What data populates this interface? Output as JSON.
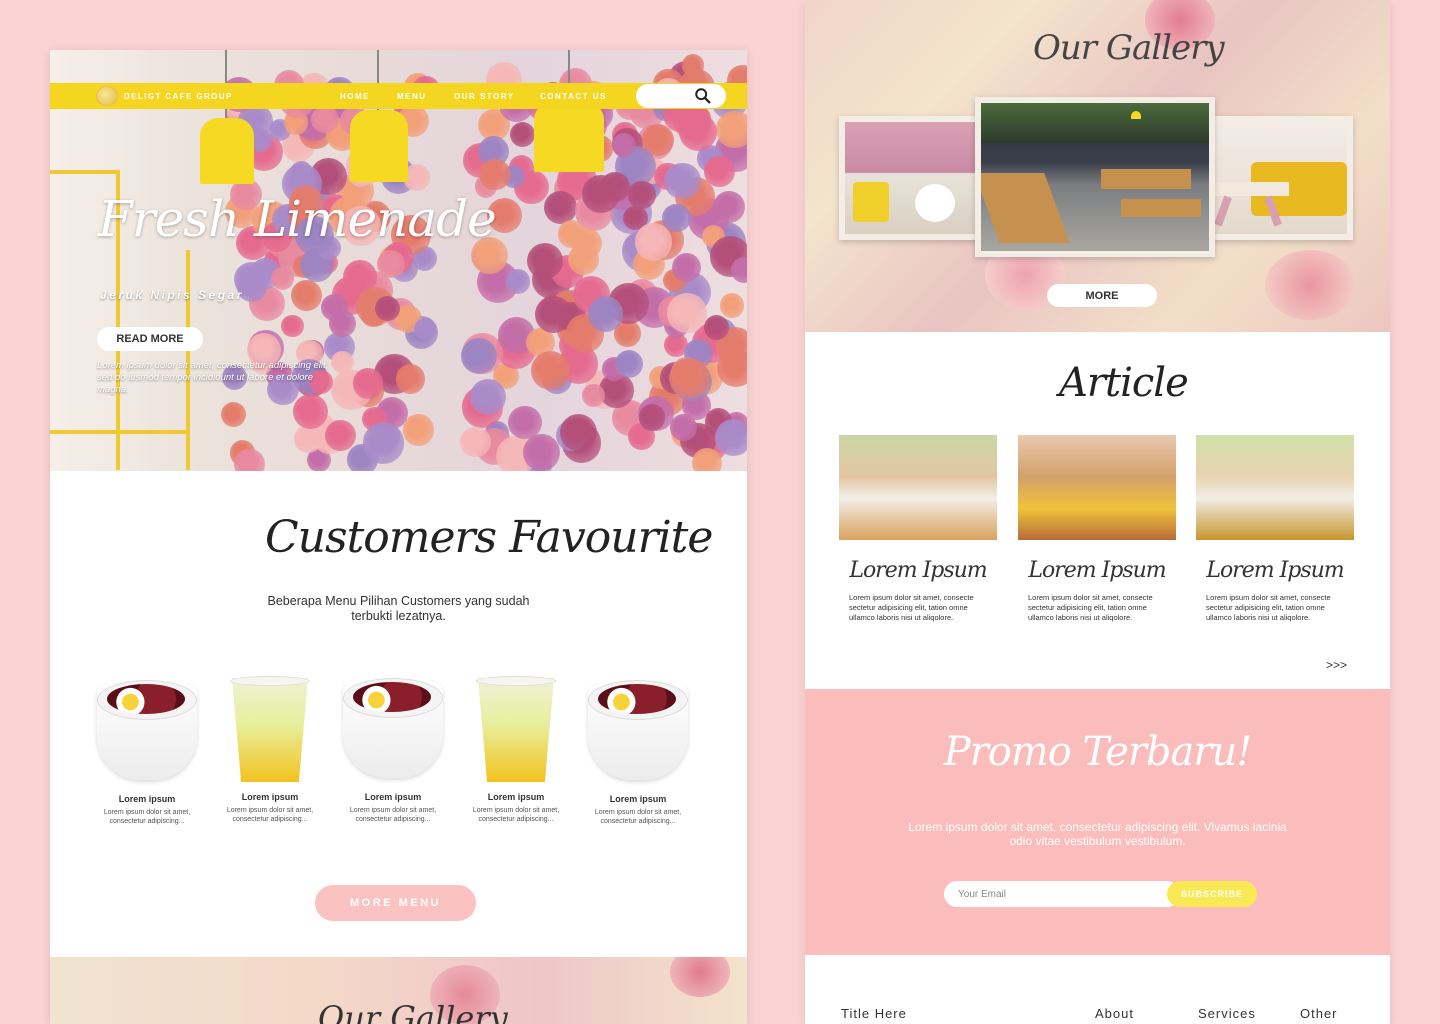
{
  "brand": {
    "name": "DELIGT CAFE GROUP"
  },
  "nav": {
    "items": [
      "HOME",
      "MENU",
      "OUR STORY",
      "CONTACT US"
    ],
    "search_icon": "search-icon"
  },
  "hero": {
    "title": "Fresh Limenade",
    "subtitle": "Jeruk Nipis Segar",
    "button": "READ MORE",
    "body": "Lorem ipsum dolor sit amet, consectetur adipiscing elit, sed do iusmod tempor incididunt ut labore et dolore magna."
  },
  "favourites": {
    "title": "Customers Favourite",
    "subtitle": "Beberapa Menu Pilihan Customers yang sudah terbukti lezatnya.",
    "products": [
      {
        "name": "Lorem ipsum",
        "desc": "Lorem ipsum dolor sit amet, consectetur adipiscing...",
        "kind": "bowl"
      },
      {
        "name": "Lorem ipsum",
        "desc": "Lorem ipsum dolor sit amet, consectetur adipiscing...",
        "kind": "cup"
      },
      {
        "name": "Lorem ipsum",
        "desc": "Lorem ipsum dolor sit amet, consectetur adipiscing...",
        "kind": "bowl"
      },
      {
        "name": "Lorem ipsum",
        "desc": "Lorem ipsum dolor sit amet, consectetur adipiscing...",
        "kind": "cup"
      },
      {
        "name": "Lorem ipsum",
        "desc": "Lorem ipsum dolor sit amet, consectetur adipiscing...",
        "kind": "bowl"
      }
    ],
    "more_button": "MORE MENU"
  },
  "gallery": {
    "title": "Our Gallery",
    "button": "MORE"
  },
  "articles": {
    "title": "Article",
    "items": [
      {
        "title": "Lorem Ipsum",
        "body": "Lorem ipsum dolor sit amet, consecte sectetur adipisicing elit, tation omne ullamco laboris nisi ut aliqolore."
      },
      {
        "title": "Lorem Ipsum",
        "body": "Lorem ipsum dolor sit amet, consecte sectetur adipisicing elit, tation omne ullamco laboris nisi ut aliqolore."
      },
      {
        "title": "Lorem Ipsum",
        "body": "Lorem ipsum dolor sit amet, consecte sectetur adipisicing elit, tation omne ullamco laboris nisi ut aliqolore."
      }
    ],
    "next": ">>>"
  },
  "promo": {
    "title": "Promo Terbaru!",
    "text": "Lorem ipsum dolor sit amet, consectetur adipiscing elit. Vivamus lacinia odio vitae vestibulum vestibulum.",
    "email_placeholder": "Your Email",
    "subscribe": "SUBSCRIBE"
  },
  "footer": {
    "title": "Title Here",
    "links": [
      "About",
      "Services",
      "Other"
    ]
  },
  "colors": {
    "background": "#fbd3d3",
    "nav_yellow": "#f4d51f",
    "pink_button": "#fbc2c2",
    "promo_pink": "#fbbcbc",
    "subscribe_yellow": "#f9ea55"
  }
}
